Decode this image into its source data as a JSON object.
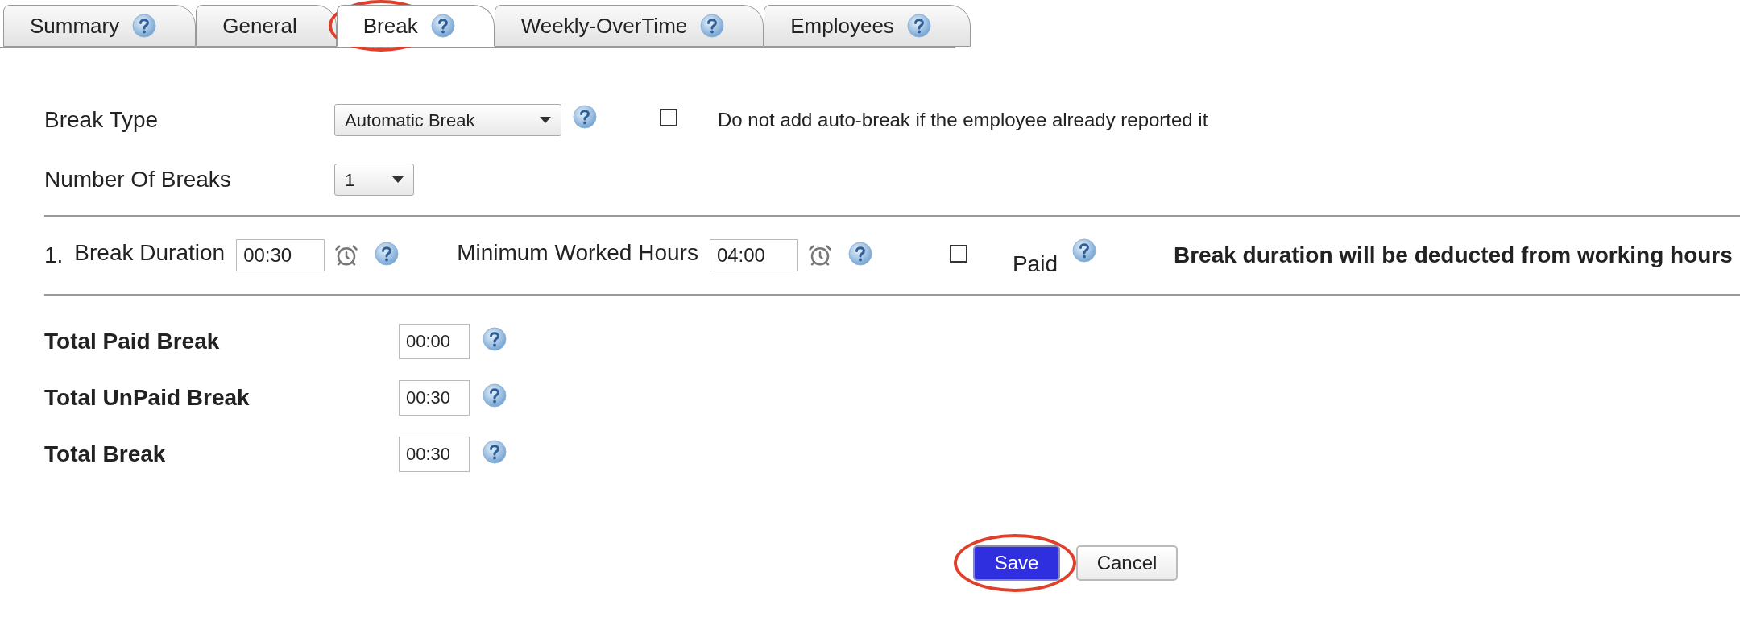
{
  "tabs": [
    {
      "label": "Summary",
      "selected": false,
      "help": true,
      "circled": false
    },
    {
      "label": "General",
      "selected": false,
      "help": false,
      "circled": false
    },
    {
      "label": "Break",
      "selected": true,
      "help": true,
      "circled": true
    },
    {
      "label": "Weekly-OverTime",
      "selected": false,
      "help": true,
      "circled": false
    },
    {
      "label": "Employees",
      "selected": false,
      "help": true,
      "circled": false
    }
  ],
  "break_type": {
    "label": "Break Type",
    "value": "Automatic Break",
    "checkbox": {
      "label": "Do not add auto-break if the employee already reported it",
      "checked": false
    }
  },
  "number_of_breaks": {
    "label": "Number Of Breaks",
    "value": "1"
  },
  "breaks": [
    {
      "number": "1.",
      "duration_label": "Break Duration",
      "duration": "00:30",
      "min_hours_label": "Minimum Worked Hours",
      "min_hours": "04:00",
      "paid_label": "Paid",
      "paid": false,
      "note": "Break duration will be deducted from working hours"
    }
  ],
  "totals": [
    {
      "label": "Total Paid Break",
      "value": "00:00"
    },
    {
      "label": "Total UnPaid Break",
      "value": "00:30"
    },
    {
      "label": "Total Break",
      "value": "00:30"
    }
  ],
  "buttons": [
    {
      "label": "Save",
      "kind": "primary",
      "circled": true
    },
    {
      "label": "Cancel",
      "kind": "secondary",
      "circled": false
    }
  ]
}
